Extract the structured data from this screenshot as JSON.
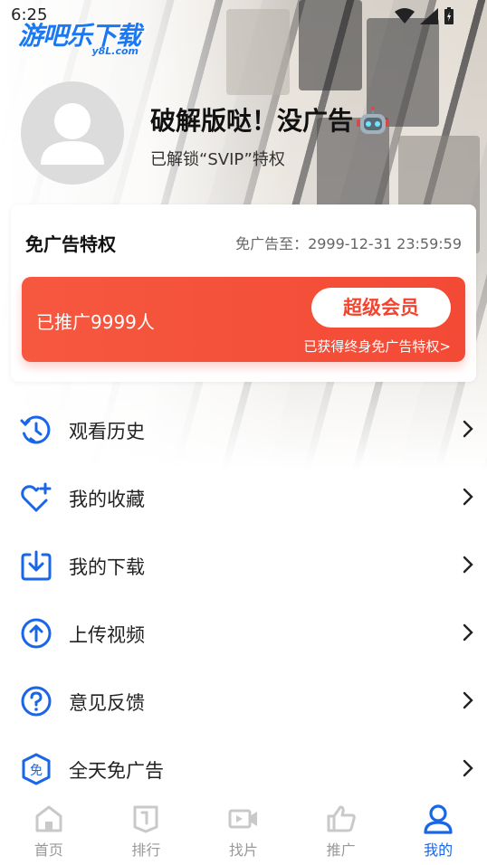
{
  "status_bar": {
    "time": "6:25"
  },
  "logo": {
    "main": "游吧乐下载",
    "sub": "y8L.com"
  },
  "profile": {
    "username": "破解版哒！没广告",
    "subtitle": "已解锁“SVIP”特权"
  },
  "privilege_card": {
    "title": "免广告特权",
    "expire_text": "免广告至：2999-12-31 23:59:59",
    "promo_count": "已推广9999人",
    "vip_button": "超级会员",
    "note": "已获得终身免广告特权>"
  },
  "menu": {
    "items": [
      {
        "label": "观看历史",
        "icon": "history-icon"
      },
      {
        "label": "我的收藏",
        "icon": "favorite-heart-icon"
      },
      {
        "label": "我的下载",
        "icon": "download-icon"
      },
      {
        "label": "上传视频",
        "icon": "upload-icon"
      },
      {
        "label": "意见反馈",
        "icon": "feedback-question-icon"
      },
      {
        "label": "全天免广告",
        "icon": "ad-free-shield-icon"
      }
    ]
  },
  "tabbar": {
    "tabs": [
      {
        "label": "首页",
        "icon": "home-icon"
      },
      {
        "label": "排行",
        "icon": "ranking-icon"
      },
      {
        "label": "找片",
        "icon": "video-camera-icon"
      },
      {
        "label": "推广",
        "icon": "thumbs-up-icon"
      },
      {
        "label": "我的",
        "icon": "user-icon"
      }
    ],
    "active_index": 4
  },
  "colors": {
    "accent_blue": "#1a66e8",
    "promo_red": "#f34a36",
    "inactive_gray": "#999999"
  }
}
